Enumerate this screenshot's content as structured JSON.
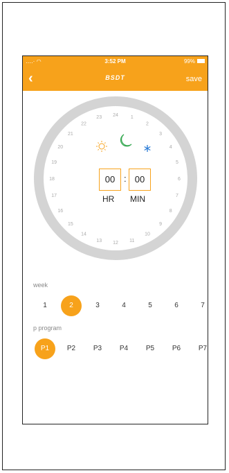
{
  "status_bar": {
    "signal": "‥‥· ◠",
    "time": "3:52 PM",
    "battery": "99%"
  },
  "nav": {
    "back_icon": "‹",
    "logo": "BSDT",
    "save_label": "save"
  },
  "dial": {
    "hours": [
      "24",
      "1",
      "2",
      "3",
      "4",
      "5",
      "6",
      "7",
      "8",
      "9",
      "10",
      "11",
      "12",
      "13",
      "14",
      "15",
      "16",
      "17",
      "18",
      "19",
      "20",
      "21",
      "22",
      "23"
    ],
    "icons": [
      "sun-icon",
      "moon-icon",
      "snowflake-icon"
    ],
    "hour_value": "00",
    "minute_value": "00",
    "separator": ":",
    "hour_unit": "HR",
    "minute_unit": "MIN"
  },
  "week": {
    "label": "week",
    "days": [
      "1",
      "2",
      "3",
      "4",
      "5",
      "6",
      "7"
    ],
    "selected_index": 1
  },
  "program": {
    "label": "p program",
    "items": [
      "P1",
      "P2",
      "P3",
      "P4",
      "P5",
      "P6",
      "P7"
    ],
    "selected_index": 0
  },
  "colors": {
    "accent": "#f7a21b",
    "ring": "#d4d4d4",
    "moon": "#3aaa55",
    "snow": "#2a7bd6"
  }
}
